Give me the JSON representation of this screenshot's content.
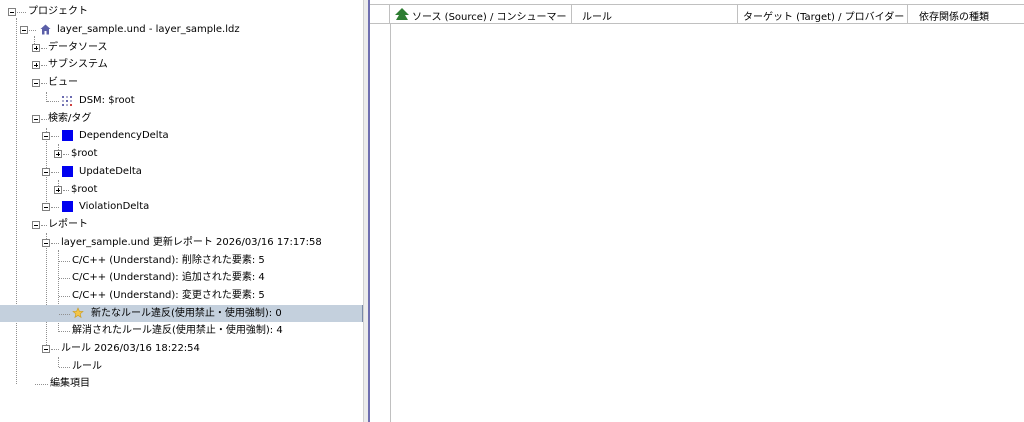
{
  "tree": {
    "project": "プロジェクト",
    "file": "layer_sample.und - layer_sample.ldz",
    "data_source": "データソース",
    "subsystem": "サブシステム",
    "view": "ビュー",
    "dsm": "DSM: $root",
    "search_tag": "検索/タグ",
    "dependency_delta": "DependencyDelta",
    "dep_root": "$root",
    "update_delta": "UpdateDelta",
    "upd_root": "$root",
    "violation_delta": "ViolationDelta",
    "report": "レポート",
    "update_report": "layer_sample.und 更新レポート 2026/03/16 17:17:58",
    "deleted": "C/C++ (Understand): 削除された要素: 5",
    "added": "C/C++ (Understand): 追加された要素: 4",
    "changed": "C/C++ (Understand): 変更された要素: 5",
    "new_violation": "新たなルール違反(使用禁止・使用強制): 0",
    "resolved_violation": "解消されたルール違反(使用禁止・使用強制): 4",
    "rules_run": "ルール 2026/03/16 18:22:54",
    "rule": "ルール",
    "edit_items": "編集項目"
  },
  "table": {
    "columns": [
      "ソース (Source) / コンシューマー (Co...",
      "ルール",
      "ターゲット (Target) / プロバイダー (Pro",
      "依存関係の種類"
    ]
  },
  "colors": {
    "selection": "#c4d0dd",
    "tag_square": "#0000f0",
    "sort_arrow": "#2e7d32",
    "splitter_border": "#6f6fb0"
  }
}
